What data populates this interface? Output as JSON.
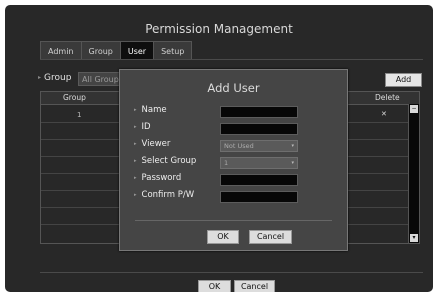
{
  "window": {
    "title": "Permission Management"
  },
  "tabs": [
    "Admin",
    "Group",
    "User",
    "Setup"
  ],
  "group_filter": {
    "label": "Group",
    "value": "All Group"
  },
  "toolbar": {
    "add_label": "Add"
  },
  "table": {
    "headers": {
      "group": "Group",
      "delete": "Delete"
    },
    "rows": [
      {
        "group": "1",
        "delete": "✕"
      }
    ]
  },
  "footer": {
    "ok_label": "OK",
    "cancel_label": "Cancel"
  },
  "dialog": {
    "title": "Add User",
    "fields": {
      "name": "Name",
      "id": "ID",
      "viewer": "Viewer",
      "select_group": "Select Group",
      "password": "Password",
      "confirm": "Confirm P/W"
    },
    "viewer_value": "Not Used",
    "group_value": "1",
    "ok_label": "OK",
    "cancel_label": "Cancel"
  },
  "colors": {
    "background": "#282828",
    "dialog": "#454545",
    "active_tab": "#0e0e0e"
  }
}
